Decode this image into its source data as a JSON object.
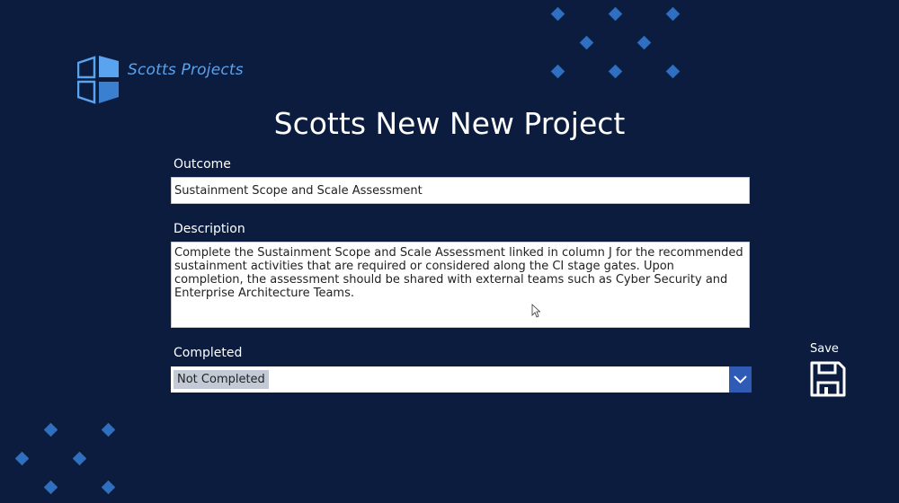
{
  "brand": {
    "name": "Scotts Projects",
    "logo_icon": "building-logo-icon"
  },
  "page": {
    "title": "Scotts New New Project"
  },
  "form": {
    "outcome": {
      "label": "Outcome",
      "value": "Sustainment Scope and Scale Assessment"
    },
    "description": {
      "label": "Description",
      "value": "Complete the Sustainment Scope and Scale Assessment linked in column J for the recommended sustainment activities that are required or considered along the CI stage gates. Upon completion, the assessment should be shared with external teams such as Cyber Security and Enterprise Architecture Teams."
    },
    "completed": {
      "label": "Completed",
      "value": "Not Completed"
    }
  },
  "actions": {
    "save_label": "Save",
    "save_icon": "floppy-disk-icon"
  },
  "colors": {
    "background": "#0b1c3f",
    "accent": "#2f5bb5",
    "diamond": "#2f6fbf",
    "brand_text": "#5aa3ee"
  }
}
